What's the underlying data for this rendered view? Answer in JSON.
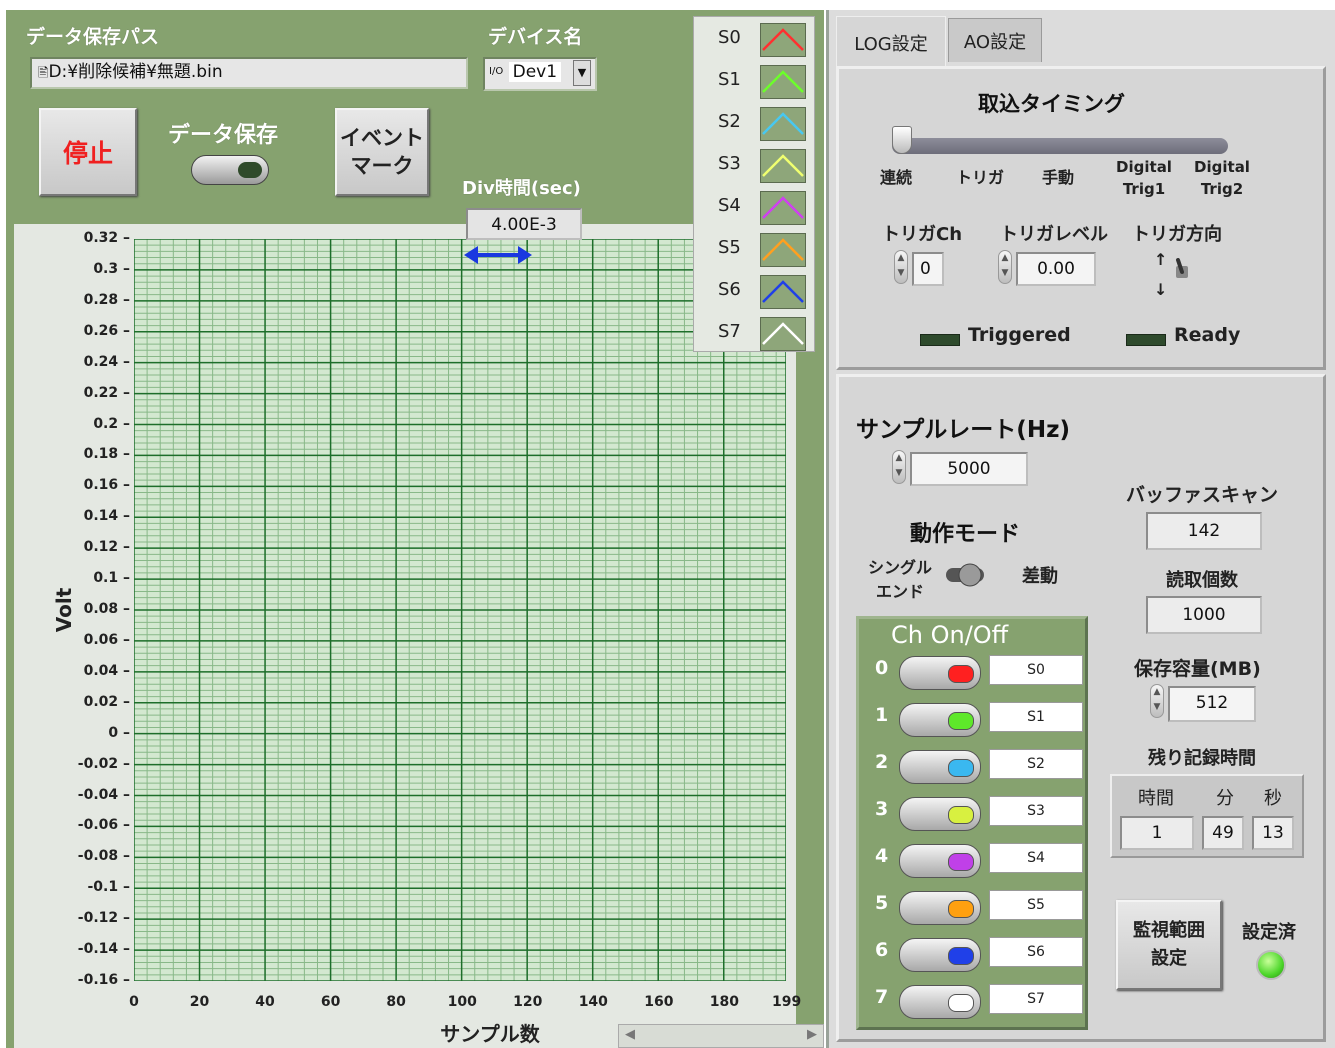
{
  "left": {
    "path_label": "データ保存パス",
    "path_prefix": "🖹",
    "path_value": "D:¥削除候補¥無題.bin",
    "device_label": "デバイス名",
    "device_prefix": "I/O",
    "device_value": "Dev1",
    "stop_button": "停止",
    "save_label": "データ保存",
    "event_button_line1": "イベント",
    "event_button_line2": "マーク",
    "div_label": "Div時間(sec)",
    "div_value": "4.00E-3"
  },
  "legend": [
    {
      "name": "S0",
      "color": "#ff3030"
    },
    {
      "name": "S1",
      "color": "#6cff2a"
    },
    {
      "name": "S2",
      "color": "#48c8f0"
    },
    {
      "name": "S3",
      "color": "#f0ff70"
    },
    {
      "name": "S4",
      "color": "#d040f0"
    },
    {
      "name": "S5",
      "color": "#ffa020"
    },
    {
      "name": "S6",
      "color": "#1f3fe8"
    },
    {
      "name": "S7",
      "color": "#ffffff"
    }
  ],
  "chart_data": {
    "type": "line",
    "xlabel": "サンプル数",
    "ylabel": "Volt",
    "xlim": [
      0,
      199
    ],
    "ylim": [
      -0.16,
      0.32
    ],
    "x_ticks": [
      "0",
      "20",
      "40",
      "60",
      "80",
      "100",
      "120",
      "140",
      "160",
      "180",
      "199"
    ],
    "y_ticks": [
      "0.32",
      "0.3",
      "0.28",
      "0.26",
      "0.24",
      "0.22",
      "0.2",
      "0.18",
      "0.16",
      "0.14",
      "0.12",
      "0.1",
      "0.08",
      "0.06",
      "0.04",
      "0.02",
      "0",
      "-0.02",
      "-0.04",
      "-0.06",
      "-0.08",
      "-0.1",
      "-0.12",
      "-0.14",
      "-0.16"
    ],
    "grid": true,
    "series": []
  },
  "right": {
    "tab_log": "LOG設定",
    "tab_ao": "AO設定",
    "timing_title": "取込タイミング",
    "timing_options": [
      "連続",
      "トリガ",
      "手動"
    ],
    "timing_digital1_l1": "Digital",
    "timing_digital1_l2": "Trig1",
    "timing_digital2_l1": "Digital",
    "timing_digital2_l2": "Trig2",
    "timing_selected": "連続",
    "trig_ch_label": "トリガCh",
    "trig_ch_value": "0",
    "trig_level_label": "トリガレベル",
    "trig_level_value": "0.00",
    "trig_dir_label": "トリガ方向",
    "trig_dir_up": "↑",
    "trig_dir_down": "↓",
    "triggered_label": "Triggered",
    "ready_label": "Ready",
    "sample_rate_label": "サンプルレート(Hz)",
    "sample_rate_value": "5000",
    "buffer_label": "バッファスキャン",
    "buffer_value": "142",
    "read_count_label": "読取個数",
    "read_count_value": "1000",
    "mode_label": "動作モード",
    "mode_single_l1": "シングル",
    "mode_single_l2": "エンド",
    "mode_diff": "差動",
    "capacity_label": "保存容量(MB)",
    "capacity_value": "512",
    "remain_label": "残り記録時間",
    "remain_h_label": "時間",
    "remain_m_label": "分",
    "remain_s_label": "秒",
    "remain_h": "1",
    "remain_m": "49",
    "remain_s": "13",
    "monitor_button_l1": "監視範囲",
    "monitor_button_l2": "設定",
    "configured_label": "設定済",
    "configured_color": "#4cd62a"
  },
  "channels": {
    "title": "Ch On/Off",
    "items": [
      {
        "num": "0",
        "name": "S0",
        "color": "#ff2020"
      },
      {
        "num": "1",
        "name": "S1",
        "color": "#5ee82a"
      },
      {
        "num": "2",
        "name": "S2",
        "color": "#3ab8f0"
      },
      {
        "num": "3",
        "name": "S3",
        "color": "#d8f040"
      },
      {
        "num": "4",
        "name": "S4",
        "color": "#c040e8"
      },
      {
        "num": "5",
        "name": "S5",
        "color": "#ffa010"
      },
      {
        "num": "6",
        "name": "S6",
        "color": "#2040e8"
      },
      {
        "num": "7",
        "name": "S7",
        "color": "#ffffff"
      }
    ]
  }
}
